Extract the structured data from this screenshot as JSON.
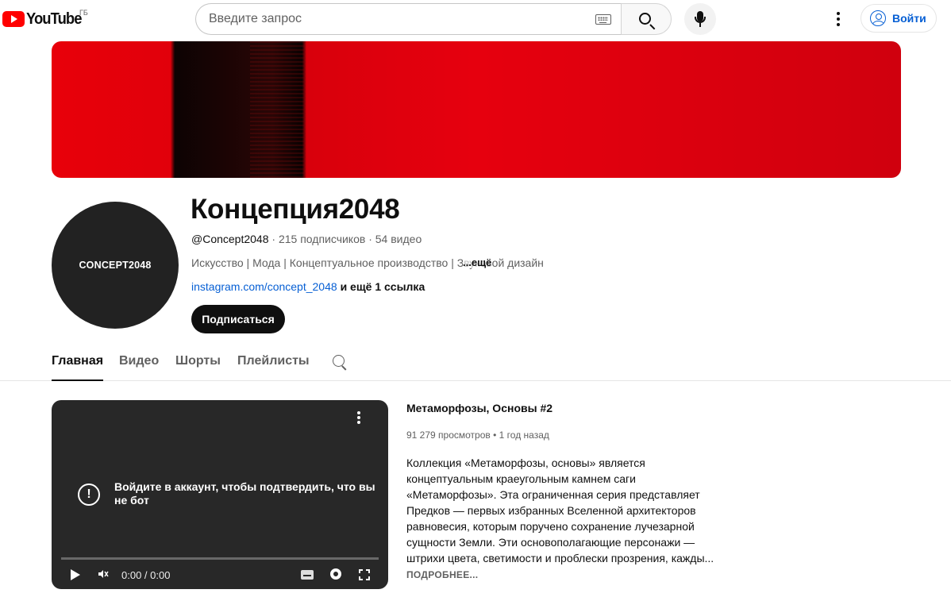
{
  "header": {
    "logo_text": "YouTube",
    "region": "ГБ",
    "search_placeholder": "Введите запрос",
    "signin_label": "Войти"
  },
  "channel": {
    "avatar_text": "CONCEPT2048",
    "title": "Концепция2048",
    "handle": "@Concept2048",
    "subscribers": "215 подписчиков",
    "videos": "54 видео",
    "description": "Искусство | Мода | Концептуальное производство | Звуковой дизайн",
    "description_more": "...ещё",
    "link": "instagram.com/concept_2048",
    "more_links": "и ещё 1 ссылка",
    "subscribe_label": "Подписаться"
  },
  "tabs": [
    {
      "label": "Главная",
      "active": true
    },
    {
      "label": "Видео",
      "active": false
    },
    {
      "label": "Шорты",
      "active": false
    },
    {
      "label": "Плейлисты",
      "active": false
    }
  ],
  "player": {
    "message": "Войдите в аккаунт, чтобы подтвердить, что вы не бот",
    "time": "0:00 / 0:00"
  },
  "featured_video": {
    "title": "Метаморфозы, Основы #2",
    "views": "91 279 просмотров",
    "age": "1 год назад",
    "description": "Коллекция «Метаморфозы, основы» является концептуальным краеугольным камнем саги «Метаморфозы». Эта ограниченная серия представляет Предков — первых избранных Вселенной архитекторов равновесия, которым поручено сохранение лучезарной сущности Земли. Эти основополагающие персонажи — штрихи цвета, светимости и проблески прозрения, кажды...",
    "more_label": "ПОДРОБНЕЕ..."
  },
  "colors": {
    "brand_red": "#ff0000",
    "link_blue": "#065fd4",
    "text": "#0f0f0f",
    "secondary_text": "#606060"
  }
}
